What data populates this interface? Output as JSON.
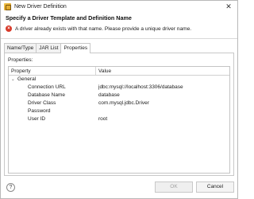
{
  "window": {
    "title": "New Driver Definition"
  },
  "header": {
    "title": "Specify a Driver Template and Definition Name",
    "message": "A driver already exists with that name. Please provide a unique driver name."
  },
  "tabs": [
    {
      "label": "Name/Type",
      "active": false
    },
    {
      "label": "JAR List",
      "active": false
    },
    {
      "label": "Properties",
      "active": true
    }
  ],
  "properties_panel": {
    "label": "Properties:",
    "columns": [
      "Property",
      "Value"
    ],
    "group": "General",
    "rows": [
      {
        "property": "Connection URL",
        "value": "jdbc:mysql://localhost:3306/database"
      },
      {
        "property": "Database Name",
        "value": "database"
      },
      {
        "property": "Driver Class",
        "value": "com.mysql.jdbc.Driver"
      },
      {
        "property": "Password",
        "value": ""
      },
      {
        "property": "User ID",
        "value": "root"
      }
    ]
  },
  "footer": {
    "help": "?",
    "ok_label": "OK",
    "cancel_label": "Cancel"
  },
  "icons": {
    "title_icon": "driver-definition-icon",
    "error_icon": "error-icon",
    "close_icon": "close-icon",
    "help_icon": "help-icon"
  },
  "colors": {
    "error": "#d83a2a"
  }
}
